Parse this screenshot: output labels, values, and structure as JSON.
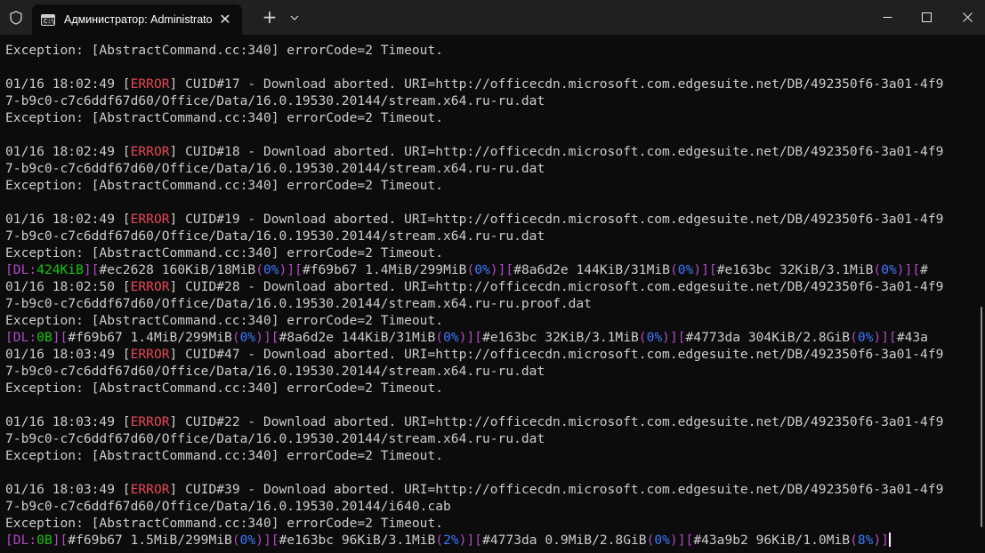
{
  "window": {
    "tab_title": "Администратор: Administrato",
    "tab_icon_text": "C:\\",
    "new_tab_label": "+"
  },
  "console": {
    "lines": [
      [
        {
          "t": "Exception: [AbstractCommand.cc:340] errorCode=2 Timeout."
        }
      ],
      [],
      [
        {
          "t": "01/16 18:02:49 ["
        },
        {
          "t": "ERROR",
          "c": "err"
        },
        {
          "t": "] CUID#17 - Download aborted. URI=http://officecdn.microsoft.com.edgesuite.net/DB/492350f6-3a01-4f9"
        }
      ],
      [
        {
          "t": "7-b9c0-c7c6ddf67d60/Office/Data/16.0.19530.20144/stream.x64.ru-ru.dat"
        }
      ],
      [
        {
          "t": "Exception: [AbstractCommand.cc:340] errorCode=2 Timeout."
        }
      ],
      [],
      [
        {
          "t": "01/16 18:02:49 ["
        },
        {
          "t": "ERROR",
          "c": "err"
        },
        {
          "t": "] CUID#18 - Download aborted. URI=http://officecdn.microsoft.com.edgesuite.net/DB/492350f6-3a01-4f9"
        }
      ],
      [
        {
          "t": "7-b9c0-c7c6ddf67d60/Office/Data/16.0.19530.20144/stream.x64.ru-ru.dat"
        }
      ],
      [
        {
          "t": "Exception: [AbstractCommand.cc:340] errorCode=2 Timeout."
        }
      ],
      [],
      [
        {
          "t": "01/16 18:02:49 ["
        },
        {
          "t": "ERROR",
          "c": "err"
        },
        {
          "t": "] CUID#19 - Download aborted. URI=http://officecdn.microsoft.com.edgesuite.net/DB/492350f6-3a01-4f9"
        }
      ],
      [
        {
          "t": "7-b9c0-c7c6ddf67d60/Office/Data/16.0.19530.20144/stream.x64.ru-ru.dat"
        }
      ],
      [
        {
          "t": "Exception: [AbstractCommand.cc:340] errorCode=2 Timeout."
        }
      ],
      [
        {
          "t": "[",
          "c": "pur"
        },
        {
          "t": "DL:",
          "c": "pur"
        },
        {
          "t": "424KiB",
          "c": "grn"
        },
        {
          "t": "][",
          "c": "pur"
        },
        {
          "t": "#ec2628 160KiB/18MiB"
        },
        {
          "t": "(",
          "c": "pur"
        },
        {
          "t": "0%",
          "c": "blu"
        },
        {
          "t": ")",
          "c": "pur"
        },
        {
          "t": "][",
          "c": "pur"
        },
        {
          "t": "#f69b67 1.4MiB/299MiB"
        },
        {
          "t": "(",
          "c": "pur"
        },
        {
          "t": "0%",
          "c": "blu"
        },
        {
          "t": ")",
          "c": "pur"
        },
        {
          "t": "][",
          "c": "pur"
        },
        {
          "t": "#8a6d2e 144KiB/31MiB"
        },
        {
          "t": "(",
          "c": "pur"
        },
        {
          "t": "0%",
          "c": "blu"
        },
        {
          "t": ")",
          "c": "pur"
        },
        {
          "t": "][",
          "c": "pur"
        },
        {
          "t": "#e163bc 32KiB/3.1MiB"
        },
        {
          "t": "(",
          "c": "pur"
        },
        {
          "t": "0%",
          "c": "blu"
        },
        {
          "t": ")",
          "c": "pur"
        },
        {
          "t": "][",
          "c": "pur"
        },
        {
          "t": "#"
        }
      ],
      [
        {
          "t": "01/16 18:02:50 ["
        },
        {
          "t": "ERROR",
          "c": "err"
        },
        {
          "t": "] CUID#28 - Download aborted. URI=http://officecdn.microsoft.com.edgesuite.net/DB/492350f6-3a01-4f9"
        }
      ],
      [
        {
          "t": "7-b9c0-c7c6ddf67d60/Office/Data/16.0.19530.20144/stream.x64.ru-ru.proof.dat"
        }
      ],
      [
        {
          "t": "Exception: [AbstractCommand.cc:340] errorCode=2 Timeout."
        }
      ],
      [
        {
          "t": "[",
          "c": "pur"
        },
        {
          "t": "DL:",
          "c": "pur"
        },
        {
          "t": "0B",
          "c": "grn"
        },
        {
          "t": "][",
          "c": "pur"
        },
        {
          "t": "#f69b67 1.4MiB/299MiB"
        },
        {
          "t": "(",
          "c": "pur"
        },
        {
          "t": "0%",
          "c": "blu"
        },
        {
          "t": ")",
          "c": "pur"
        },
        {
          "t": "][",
          "c": "pur"
        },
        {
          "t": "#8a6d2e 144KiB/31MiB"
        },
        {
          "t": "(",
          "c": "pur"
        },
        {
          "t": "0%",
          "c": "blu"
        },
        {
          "t": ")",
          "c": "pur"
        },
        {
          "t": "][",
          "c": "pur"
        },
        {
          "t": "#e163bc 32KiB/3.1MiB"
        },
        {
          "t": "(",
          "c": "pur"
        },
        {
          "t": "0%",
          "c": "blu"
        },
        {
          "t": ")",
          "c": "pur"
        },
        {
          "t": "][",
          "c": "pur"
        },
        {
          "t": "#4773da 304KiB/2.8GiB"
        },
        {
          "t": "(",
          "c": "pur"
        },
        {
          "t": "0%",
          "c": "blu"
        },
        {
          "t": ")",
          "c": "pur"
        },
        {
          "t": "][",
          "c": "pur"
        },
        {
          "t": "#43a"
        }
      ],
      [
        {
          "t": "01/16 18:03:49 ["
        },
        {
          "t": "ERROR",
          "c": "err"
        },
        {
          "t": "] CUID#47 - Download aborted. URI=http://officecdn.microsoft.com.edgesuite.net/DB/492350f6-3a01-4f9"
        }
      ],
      [
        {
          "t": "7-b9c0-c7c6ddf67d60/Office/Data/16.0.19530.20144/stream.x64.ru-ru.dat"
        }
      ],
      [
        {
          "t": "Exception: [AbstractCommand.cc:340] errorCode=2 Timeout."
        }
      ],
      [],
      [
        {
          "t": "01/16 18:03:49 ["
        },
        {
          "t": "ERROR",
          "c": "err"
        },
        {
          "t": "] CUID#22 - Download aborted. URI=http://officecdn.microsoft.com.edgesuite.net/DB/492350f6-3a01-4f9"
        }
      ],
      [
        {
          "t": "7-b9c0-c7c6ddf67d60/Office/Data/16.0.19530.20144/stream.x64.ru-ru.dat"
        }
      ],
      [
        {
          "t": "Exception: [AbstractCommand.cc:340] errorCode=2 Timeout."
        }
      ],
      [],
      [
        {
          "t": "01/16 18:03:49 ["
        },
        {
          "t": "ERROR",
          "c": "err"
        },
        {
          "t": "] CUID#39 - Download aborted. URI=http://officecdn.microsoft.com.edgesuite.net/DB/492350f6-3a01-4f9"
        }
      ],
      [
        {
          "t": "7-b9c0-c7c6ddf67d60/Office/Data/16.0.19530.20144/i640.cab"
        }
      ],
      [
        {
          "t": "Exception: [AbstractCommand.cc:340] errorCode=2 Timeout."
        }
      ],
      [
        {
          "t": "[",
          "c": "pur"
        },
        {
          "t": "DL:",
          "c": "pur"
        },
        {
          "t": "0B",
          "c": "grn"
        },
        {
          "t": "][",
          "c": "pur"
        },
        {
          "t": "#f69b67 1.5MiB/299MiB"
        },
        {
          "t": "(",
          "c": "pur"
        },
        {
          "t": "0%",
          "c": "blu"
        },
        {
          "t": ")",
          "c": "pur"
        },
        {
          "t": "][",
          "c": "pur"
        },
        {
          "t": "#e163bc 96KiB/3.1MiB"
        },
        {
          "t": "(",
          "c": "pur"
        },
        {
          "t": "2%",
          "c": "blu"
        },
        {
          "t": ")",
          "c": "pur"
        },
        {
          "t": "][",
          "c": "pur"
        },
        {
          "t": "#4773da 0.9MiB/2.8GiB"
        },
        {
          "t": "(",
          "c": "pur"
        },
        {
          "t": "0%",
          "c": "blu"
        },
        {
          "t": ")",
          "c": "pur"
        },
        {
          "t": "][",
          "c": "pur"
        },
        {
          "t": "#43a9b2 96KiB/1.0MiB"
        },
        {
          "t": "(",
          "c": "pur"
        },
        {
          "t": "8%",
          "c": "blu"
        },
        {
          "t": ")",
          "c": "pur"
        },
        {
          "t": "]",
          "c": "pur"
        }
      ]
    ]
  },
  "colors": {
    "background": "#0c0c0c",
    "titlebar": "#202020",
    "text": "#cccccc",
    "error": "#e74856",
    "bracket": "#b148c6",
    "speed": "#16c60c",
    "percent": "#3b78ff"
  },
  "icons": [
    "shield-icon",
    "terminal-icon",
    "close-icon",
    "plus-icon",
    "chevron-down-icon",
    "minimize-icon",
    "maximize-icon",
    "window-close-icon"
  ]
}
